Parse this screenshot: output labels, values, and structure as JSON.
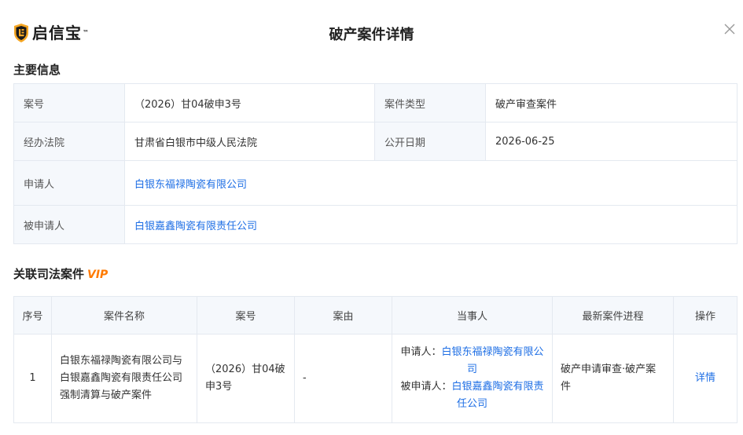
{
  "header": {
    "logo_text": "启信宝",
    "logo_tm": "™",
    "title": "破产案件详情",
    "icons": {
      "logo": "shield-logo-icon",
      "close": "close-icon"
    },
    "colors": {
      "logo": "#f5a623",
      "link": "#1f6fe5",
      "vip": "#ff7a00"
    }
  },
  "main_info": {
    "title": "主要信息",
    "case_no_label": "案号",
    "case_no": "（2026）甘04破申3号",
    "case_type_label": "案件类型",
    "case_type": "破产审查案件",
    "court_label": "经办法院",
    "court": "甘肃省白银市中级人民法院",
    "publish_date_label": "公开日期",
    "publish_date": "2026-06-25",
    "applicant_label": "申请人",
    "applicant": "白银东福禄陶瓷有限公司",
    "respondent_label": "被申请人",
    "respondent": "白银嘉鑫陶瓷有限责任公司"
  },
  "related": {
    "title": "关联司法案件",
    "vip_label": "VIP",
    "columns": [
      "序号",
      "案件名称",
      "案号",
      "案由",
      "当事人",
      "最新案件进程",
      "操作"
    ],
    "rows": [
      {
        "index": "1",
        "case_name": "白银东福禄陶瓷有限公司与白银嘉鑫陶瓷有限责任公司强制清算与破产案件",
        "case_no": "（2026）甘04破申3号",
        "cause": "-",
        "applicant_prefix": "申请人：",
        "applicant": "白银东福禄陶瓷有限公司",
        "respondent_prefix": "被申请人：",
        "respondent": "白银嘉鑫陶瓷有限责任公司",
        "progress": "破产申请审查·破产案件",
        "action": "详情"
      }
    ]
  }
}
